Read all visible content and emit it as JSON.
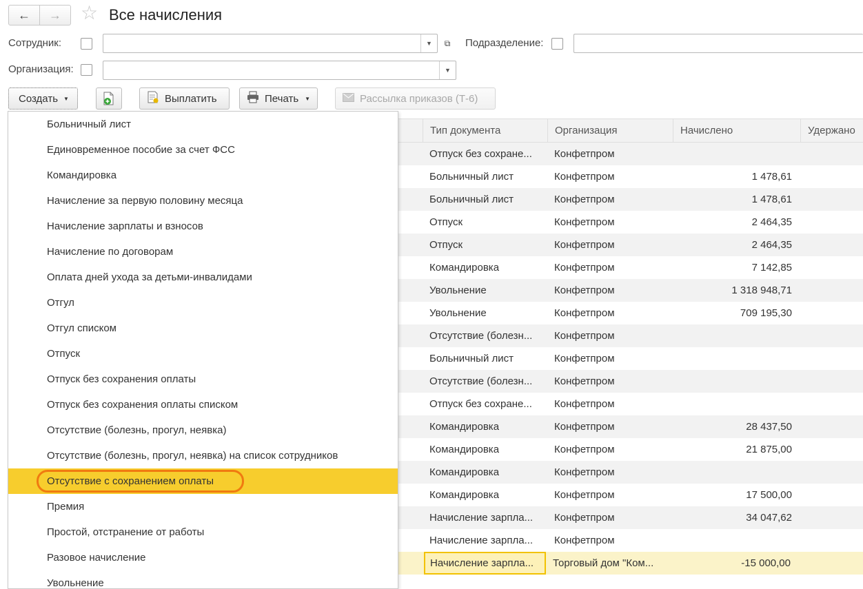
{
  "header": {
    "title": "Все начисления",
    "back": "←",
    "forward": "→",
    "favorite": "☆"
  },
  "filters": {
    "employee_label": "Сотрудник:",
    "employee_value": "",
    "department_label": "Подразделение:",
    "department_value": "",
    "organization_label": "Организация:",
    "organization_value": ""
  },
  "toolbar": {
    "create_label": "Создать",
    "pay_label": "Выплатить",
    "print_label": "Печать",
    "mailing_label": "Рассылка приказов (Т-6)"
  },
  "menu": {
    "items": [
      "Больничный лист",
      "Единовременное пособие за счет ФСС",
      "Командировка",
      "Начисление за первую половину месяца",
      "Начисление зарплаты и взносов",
      "Начисление по договорам",
      "Оплата дней ухода за детьми-инвалидами",
      "Отгул",
      "Отгул списком",
      "Отпуск",
      "Отпуск без сохранения оплаты",
      "Отпуск без сохранения оплаты списком",
      "Отсутствие (болезнь, прогул, неявка)",
      "Отсутствие (болезнь, прогул, неявка) на список сотрудников",
      "Отсутствие с сохранением оплаты",
      "Премия",
      "Простой, отстранение от работы",
      "Разовое начисление",
      "Увольнение"
    ],
    "highlighted_index": 14,
    "highlight_color": "#f7cd2d",
    "ring_color": "#f07a10"
  },
  "table": {
    "columns": [
      "Тип документа",
      "Организация",
      "Начислено",
      "Удержано"
    ],
    "rows": [
      [
        "Отпуск без сохране...",
        "Конфетпром",
        "",
        ""
      ],
      [
        "Больничный лист",
        "Конфетпром",
        "1 478,61",
        ""
      ],
      [
        "Больничный лист",
        "Конфетпром",
        "1 478,61",
        ""
      ],
      [
        "Отпуск",
        "Конфетпром",
        "2 464,35",
        ""
      ],
      [
        "Отпуск",
        "Конфетпром",
        "2 464,35",
        ""
      ],
      [
        "Командировка",
        "Конфетпром",
        "7 142,85",
        ""
      ],
      [
        "Увольнение",
        "Конфетпром",
        "1 318 948,71",
        ""
      ],
      [
        "Увольнение",
        "Конфетпром",
        "709 195,30",
        ""
      ],
      [
        "Отсутствие (болезн...",
        "Конфетпром",
        "",
        ""
      ],
      [
        "Больничный лист",
        "Конфетпром",
        "",
        ""
      ],
      [
        "Отсутствие (болезн...",
        "Конфетпром",
        "",
        ""
      ],
      [
        "Отпуск без сохране...",
        "Конфетпром",
        "",
        ""
      ],
      [
        "Командировка",
        "Конфетпром",
        "28 437,50",
        ""
      ],
      [
        "Командировка",
        "Конфетпром",
        "21 875,00",
        ""
      ],
      [
        "Командировка",
        "Конфетпром",
        "",
        ""
      ],
      [
        "Командировка",
        "Конфетпром",
        "17 500,00",
        ""
      ],
      [
        "Начисление зарпла...",
        "Конфетпром",
        "34 047,62",
        ""
      ],
      [
        "Начисление зарпла...",
        "Конфетпром",
        "",
        ""
      ],
      [
        "Начисление зарпла...",
        "Торговый дом \"Ком...",
        "-15 000,00",
        ""
      ]
    ],
    "selected_row": 18
  }
}
